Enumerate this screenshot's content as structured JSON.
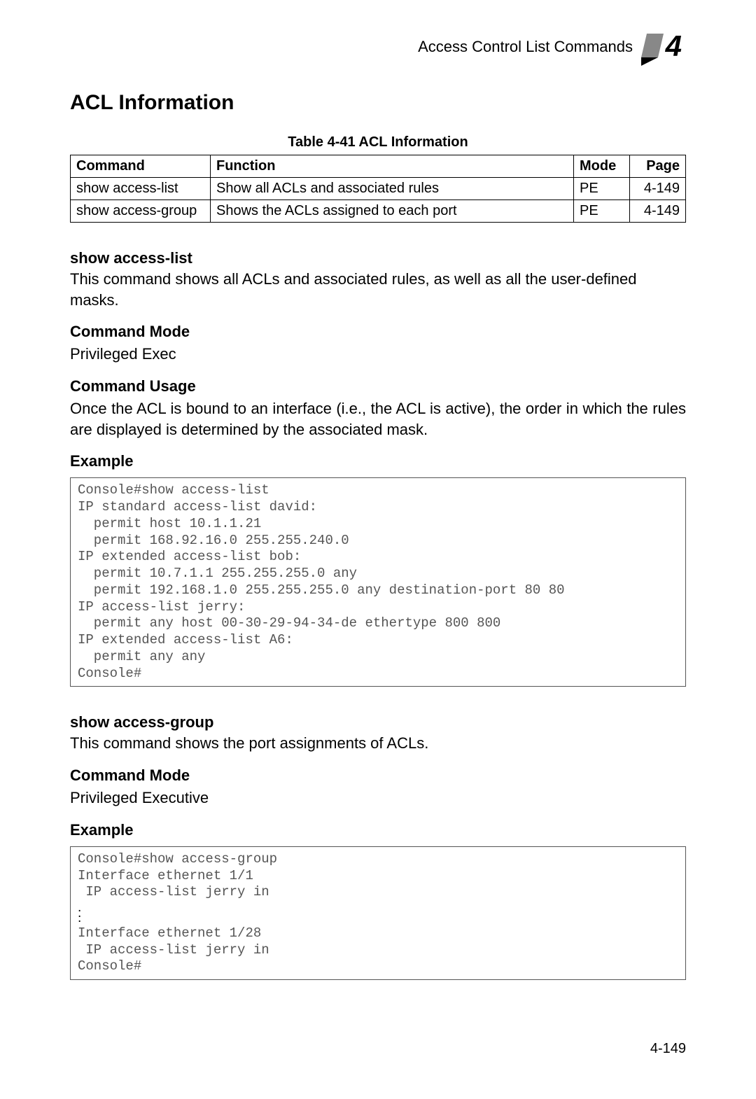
{
  "header": {
    "breadcrumb": "Access Control List Commands",
    "chapter_number": "4"
  },
  "section_title": "ACL Information",
  "table": {
    "caption": "Table 4-41  ACL Information",
    "headers": {
      "command": "Command",
      "function": "Function",
      "mode": "Mode",
      "page": "Page"
    },
    "rows": [
      {
        "command": "show access-list",
        "function": "Show all ACLs and associated rules",
        "mode": "PE",
        "page": "4-149"
      },
      {
        "command": "show access-group",
        "function": "Shows the ACLs assigned to each port",
        "mode": "PE",
        "page": "4-149"
      }
    ]
  },
  "sections": [
    {
      "title": "show access-list",
      "description": "This command shows all ACLs and associated rules, as well as all the user-defined masks.",
      "mode_label": "Command Mode",
      "mode_value": "Privileged Exec",
      "usage_label": "Command Usage",
      "usage_text": "Once the ACL is bound to an interface (i.e., the ACL is active), the order in which the rules are displayed is determined by the associated mask.",
      "example_label": "Example",
      "example_code": "Console#show access-list\nIP standard access-list david:\n  permit host 10.1.1.21\n  permit 168.92.16.0 255.255.240.0\nIP extended access-list bob:\n  permit 10.7.1.1 255.255.255.0 any\n  permit 192.168.1.0 255.255.255.0 any destination-port 80 80\nIP access-list jerry:\n  permit any host 00-30-29-94-34-de ethertype 800 800\nIP extended access-list A6:\n  permit any any\nConsole#"
    },
    {
      "title": "show access-group",
      "description": "This command shows the port assignments of ACLs.",
      "mode_label": "Command Mode",
      "mode_value": "Privileged Executive",
      "example_label": "Example",
      "example_code_pre": "Console#show access-group\nInterface ethernet 1/1\n IP access-list jerry in",
      "example_code_post": "Interface ethernet 1/28\n IP access-list jerry in\nConsole#"
    }
  ],
  "footer_page": "4-149"
}
